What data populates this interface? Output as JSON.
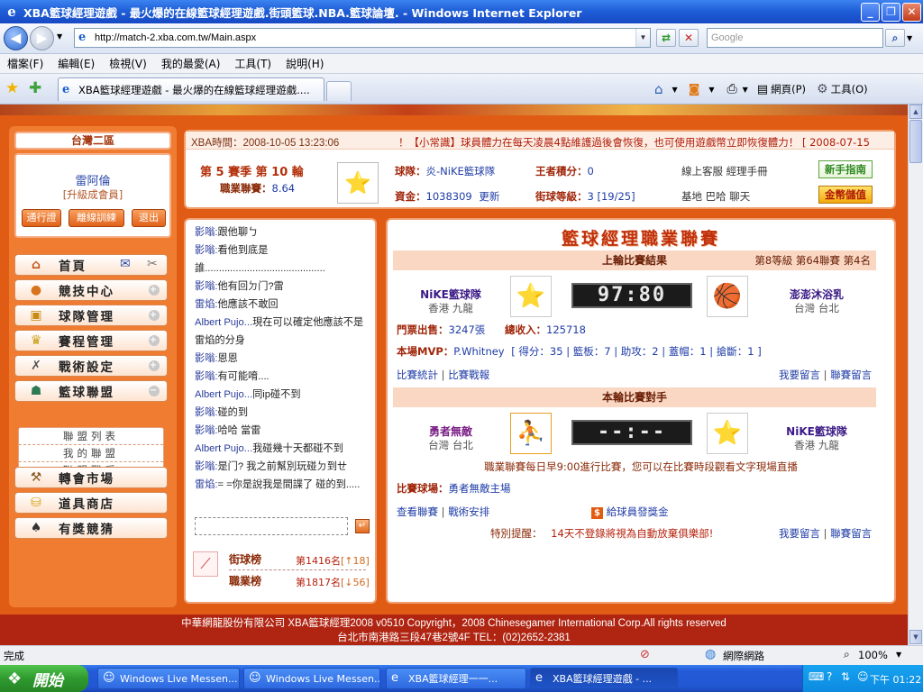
{
  "window": {
    "title": "XBA籃球經理遊戲 - 最火爆的在線籃球經理遊戲.街頭籃球.NBA.籃球論壇. - Windows Internet Explorer",
    "minimize": "_",
    "maximize": "❐",
    "close": "✕"
  },
  "address": {
    "url": "http://match-2.xba.com.tw/Main.aspx",
    "search_placeholder": "Google"
  },
  "menu": [
    "檔案(F)",
    "編輯(E)",
    "檢視(V)",
    "我的最愛(A)",
    "工具(T)",
    "說明(H)"
  ],
  "tab": {
    "label": "XBA籃球經理遊戲 - 最火爆的在線籃球經理遊戲...."
  },
  "commands": {
    "page": "網頁(P)",
    "tools": "工具(O)"
  },
  "left": {
    "area": "台灣二區",
    "username": "雷阿倫",
    "level": "[升級成會員]",
    "buttons": [
      "通行證",
      "離線訓練",
      "退出"
    ],
    "nav": [
      {
        "label": "首頁",
        "icon": "home-icon"
      },
      {
        "label": "競技中心",
        "icon": "basketball-icon"
      },
      {
        "label": "球隊管理",
        "icon": "jersey-icon"
      },
      {
        "label": "賽程管理",
        "icon": "trophy-icon"
      },
      {
        "label": "戰術設定",
        "icon": "tactics-icon"
      },
      {
        "label": "籃球聯盟",
        "icon": "people-icon"
      },
      {
        "label": "轉會市場",
        "icon": "hammer-icon"
      },
      {
        "label": "道具商店",
        "icon": "gold-icon"
      },
      {
        "label": "有獎競猜",
        "icon": "spade-icon"
      }
    ],
    "league_sub": [
      "聯盟列表",
      "我的聯盟",
      "聯盟戰爭"
    ]
  },
  "info": {
    "time_label": "XBA時間：",
    "time": "2008-10-05 13:23:06",
    "ticker": "！【小常識】球員體力在每天凌晨4點維護過後會恢復，也可使用遊戲幣立即恢復體力！ [ 2008-07-15",
    "season": "第 5 賽季  第 10 輪",
    "career_label": "職業聯賽：",
    "career_value": "8.64",
    "team_label": "球隊：",
    "team_value": "炎-NiKE籃球隊",
    "king_label": "王者積分：",
    "king_value": "0",
    "online": "線上客服  經理手冊",
    "guide_btn": "新手指南",
    "funds_label": "資金：",
    "funds_value": "1038309",
    "refresh": "更新",
    "rank_label": "街球等級：",
    "rank_value": "3 [19/25]",
    "base": "基地  巴哈  聊天",
    "gold_btn": "金幣儲值"
  },
  "chat": [
    {
      "who": "影嗡:",
      "text": "跟他聊ㄅ"
    },
    {
      "who": "影嗡:",
      "text": "看他到底是誰..........................................."
    },
    {
      "who": "影嗡:",
      "text": "他有回ㄉ门?雷"
    },
    {
      "who": "雷焰:",
      "text": "他應該不敢回"
    },
    {
      "who": "Albert Pujo...",
      "text": "現在可以確定他應該不是雷焰的分身"
    },
    {
      "who": "影嗡:",
      "text": "恩恩"
    },
    {
      "who": "影嗡:",
      "text": "有可能唷...."
    },
    {
      "who": "Albert Pujo...",
      "text": "同ip碰不到"
    },
    {
      "who": "影嗡:",
      "text": "碰的到"
    },
    {
      "who": "影嗡:",
      "text": "哈哈  當雷"
    },
    {
      "who": "Albert Pujo...",
      "text": "我碰幾十天都碰不到"
    },
    {
      "who": "影嗡:",
      "text": "是门? 我之前幫別玩碰ㄉ到ㄝ"
    },
    {
      "who": "雷焰:",
      "text": "= =你是說我是間諜了  碰的到....."
    }
  ],
  "rank": {
    "street_label": "街球榜",
    "street_value": "第1416名",
    "street_delta": "[↑18]",
    "career_label": "職業榜",
    "career_value": "第1817名",
    "career_delta": "[↓56]"
  },
  "league": {
    "title": "籃球經理職業聯賽",
    "last": {
      "header": "上輪比賽結果",
      "meta": "第8等級  第64聯賽  第4名",
      "home_name": "NiKE籃球隊",
      "home_loc": "香港  九龍",
      "score": "97:80",
      "away_name": "澎澎沐浴乳",
      "away_loc": "台灣  台北",
      "tickets_label": "門票出售：",
      "tickets_value": "3247張",
      "revenue_label": "總收入：",
      "revenue_value": "125718",
      "mvp_label": "本場MVP：",
      "mvp_value": "P.Whitney",
      "mvp_stats": "[ 得分：35 | 籃板：7 | 助攻：2 | 蓋帽：1 | 搶斷：1 ]",
      "stats_link": "比賽統計",
      "report_link": "比賽戰報",
      "msg_link": "我要留言",
      "league_msg_link": "聯賽留言"
    },
    "next": {
      "header": "本輪比賽對手",
      "home_name": "勇者無敵",
      "home_loc": "台灣  台北",
      "score": "--:--",
      "away_name": "NiKE籃球隊",
      "away_loc": "香港  九龍",
      "notice": "職業聯賽每日早9:00進行比賽，您可以在比賽時段觀看文字現場直播",
      "venue_label": "比賽球場：",
      "venue_value": "勇者無敵主場",
      "view_link": "查看聯賽",
      "tactics_link": "戰術安排",
      "bonus_link": "給球員發獎金",
      "warn_label": "特別提醒：",
      "warn_text": "14天不登錄將視為自動放棄俱樂部!",
      "msg_link": "我要留言",
      "league_msg_link": "聯賽留言"
    }
  },
  "footer": {
    "line1": "中華網龍股份有限公司  XBA籃球經理2008 v0510     Copyright，2008 Chinesegamer International Corp.All rights reserved",
    "line2": "台北市南港路三段47巷2號4F TEL：(02)2652-2381"
  },
  "status": {
    "left": "完成",
    "zone": "網際網路",
    "zoom": "100%"
  },
  "taskbar": {
    "start": "開始",
    "items": [
      "Windows Live Messen...",
      "Windows Live Messen...",
      "XBA籃球經理一一...",
      "XBA籃球經理遊戲 - ..."
    ],
    "clock": "下午 01:22"
  }
}
